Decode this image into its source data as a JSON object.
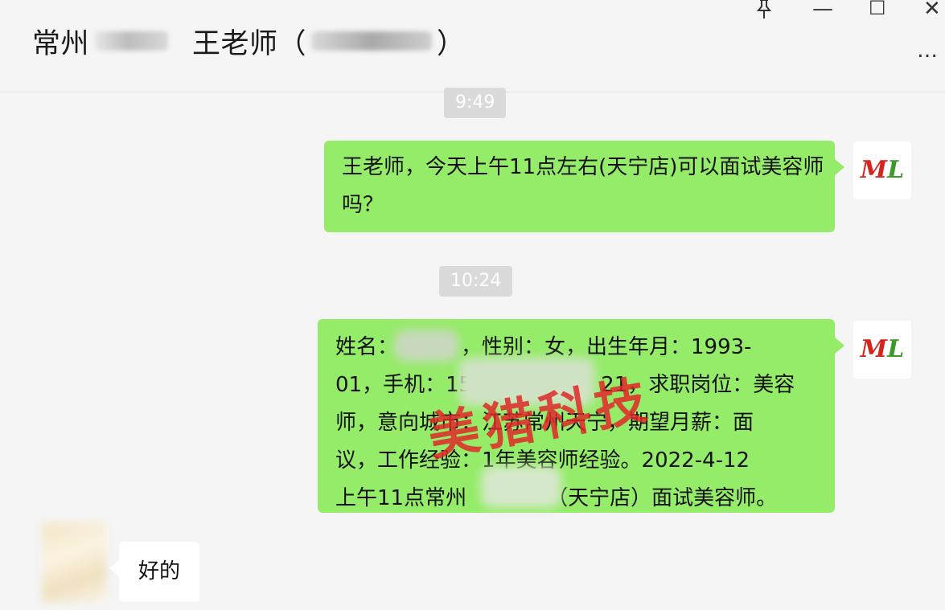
{
  "header": {
    "title_city": "常州",
    "title_contact": "王老师（",
    "title_close": "）",
    "controls": {
      "pin_icon": "pin-icon",
      "minimize_symbol": "—",
      "maximize_symbol": "☐",
      "close_symbol": "✕",
      "more_symbol": "…"
    }
  },
  "messages": {
    "time1": "9:49",
    "msg1": "王老师，今天上午11点左右(天宁店)可以面试美容师吗？",
    "time2": "10:24",
    "msg2_lines": [
      "姓名：",
      "，性别：女，出生年月：1993-",
      "01，手机：15",
      "21，求职岗位：美容",
      "师，意向城市：江苏常州天宁，期望月薪：面",
      "议，工作经验：1年美容师经验。2022-4-12",
      "上午11点常州",
      "（天宁店）面试美容师。"
    ],
    "reply": "好的"
  },
  "watermark": "美猎科技",
  "colors": {
    "bubble_green": "#95ec69",
    "time_bg": "#dadada",
    "brand_red": "#d6231d"
  }
}
